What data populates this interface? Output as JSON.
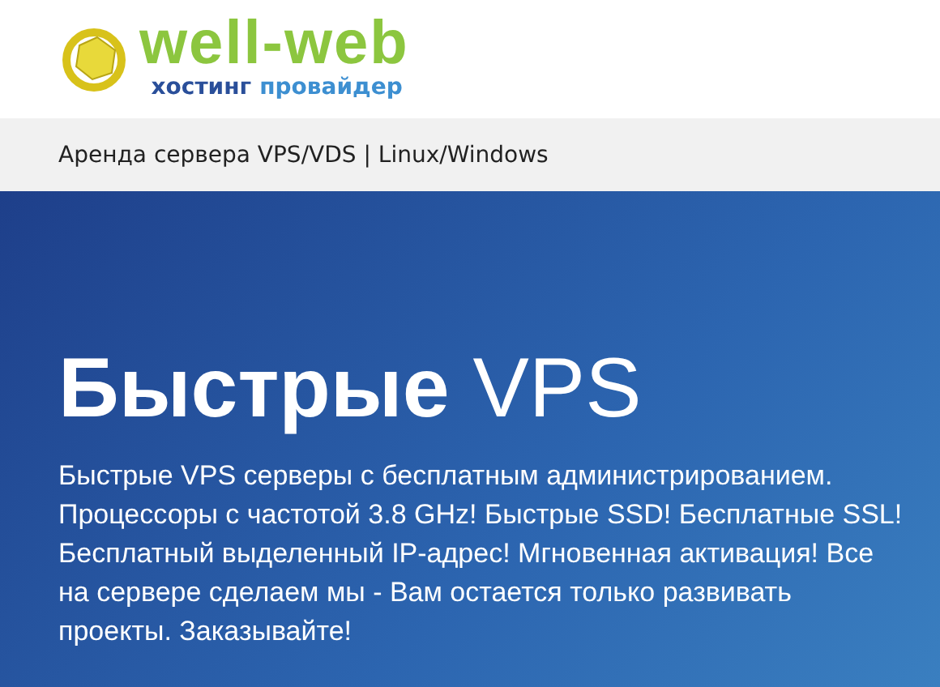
{
  "logo": {
    "name": "well-web",
    "tagline": [
      "хостинг",
      "провайдер"
    ]
  },
  "breadcrumb": "Аренда сервера VPS/VDS | Linux/Windows",
  "hero": {
    "title": "**Быстрые** VPS",
    "text": "Быстрые VPS серверы с бесплатным администрированием. Процессоры с частотой 3.8 GHz! Быстрые SSD! Бесплатные SSL! Бесплатный выделенный IP-адрес! Мгновенная активация! Все на сервере сделаем мы - Вам остается только развивать проекты. Заказывайте!"
  }
}
